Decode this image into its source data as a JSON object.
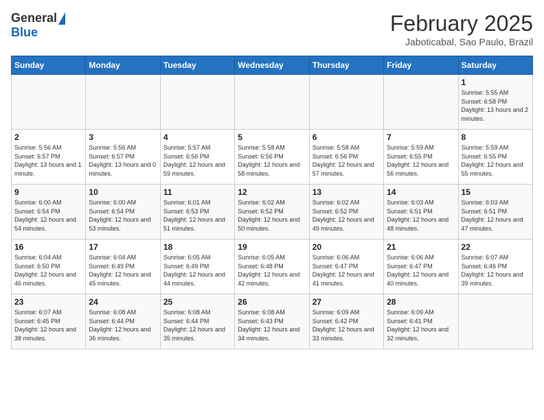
{
  "header": {
    "logo_general": "General",
    "logo_blue": "Blue",
    "month_year": "February 2025",
    "location": "Jaboticabal, Sao Paulo, Brazil"
  },
  "days_of_week": [
    "Sunday",
    "Monday",
    "Tuesday",
    "Wednesday",
    "Thursday",
    "Friday",
    "Saturday"
  ],
  "weeks": [
    [
      {
        "day": "",
        "info": ""
      },
      {
        "day": "",
        "info": ""
      },
      {
        "day": "",
        "info": ""
      },
      {
        "day": "",
        "info": ""
      },
      {
        "day": "",
        "info": ""
      },
      {
        "day": "",
        "info": ""
      },
      {
        "day": "1",
        "info": "Sunrise: 5:55 AM\nSunset: 6:58 PM\nDaylight: 13 hours and 2 minutes."
      }
    ],
    [
      {
        "day": "2",
        "info": "Sunrise: 5:56 AM\nSunset: 6:57 PM\nDaylight: 13 hours and 1 minute."
      },
      {
        "day": "3",
        "info": "Sunrise: 5:56 AM\nSunset: 6:57 PM\nDaylight: 13 hours and 0 minutes."
      },
      {
        "day": "4",
        "info": "Sunrise: 5:57 AM\nSunset: 6:56 PM\nDaylight: 12 hours and 59 minutes."
      },
      {
        "day": "5",
        "info": "Sunrise: 5:58 AM\nSunset: 6:56 PM\nDaylight: 12 hours and 58 minutes."
      },
      {
        "day": "6",
        "info": "Sunrise: 5:58 AM\nSunset: 6:56 PM\nDaylight: 12 hours and 57 minutes."
      },
      {
        "day": "7",
        "info": "Sunrise: 5:59 AM\nSunset: 6:55 PM\nDaylight: 12 hours and 56 minutes."
      },
      {
        "day": "8",
        "info": "Sunrise: 5:59 AM\nSunset: 6:55 PM\nDaylight: 12 hours and 55 minutes."
      }
    ],
    [
      {
        "day": "9",
        "info": "Sunrise: 6:00 AM\nSunset: 6:54 PM\nDaylight: 12 hours and 54 minutes."
      },
      {
        "day": "10",
        "info": "Sunrise: 6:00 AM\nSunset: 6:54 PM\nDaylight: 12 hours and 53 minutes."
      },
      {
        "day": "11",
        "info": "Sunrise: 6:01 AM\nSunset: 6:53 PM\nDaylight: 12 hours and 51 minutes."
      },
      {
        "day": "12",
        "info": "Sunrise: 6:02 AM\nSunset: 6:52 PM\nDaylight: 12 hours and 50 minutes."
      },
      {
        "day": "13",
        "info": "Sunrise: 6:02 AM\nSunset: 6:52 PM\nDaylight: 12 hours and 49 minutes."
      },
      {
        "day": "14",
        "info": "Sunrise: 6:03 AM\nSunset: 6:51 PM\nDaylight: 12 hours and 48 minutes."
      },
      {
        "day": "15",
        "info": "Sunrise: 6:03 AM\nSunset: 6:51 PM\nDaylight: 12 hours and 47 minutes."
      }
    ],
    [
      {
        "day": "16",
        "info": "Sunrise: 6:04 AM\nSunset: 6:50 PM\nDaylight: 12 hours and 46 minutes."
      },
      {
        "day": "17",
        "info": "Sunrise: 6:04 AM\nSunset: 6:49 PM\nDaylight: 12 hours and 45 minutes."
      },
      {
        "day": "18",
        "info": "Sunrise: 6:05 AM\nSunset: 6:49 PM\nDaylight: 12 hours and 44 minutes."
      },
      {
        "day": "19",
        "info": "Sunrise: 6:05 AM\nSunset: 6:48 PM\nDaylight: 12 hours and 42 minutes."
      },
      {
        "day": "20",
        "info": "Sunrise: 6:06 AM\nSunset: 6:47 PM\nDaylight: 12 hours and 41 minutes."
      },
      {
        "day": "21",
        "info": "Sunrise: 6:06 AM\nSunset: 6:47 PM\nDaylight: 12 hours and 40 minutes."
      },
      {
        "day": "22",
        "info": "Sunrise: 6:07 AM\nSunset: 6:46 PM\nDaylight: 12 hours and 39 minutes."
      }
    ],
    [
      {
        "day": "23",
        "info": "Sunrise: 6:07 AM\nSunset: 6:45 PM\nDaylight: 12 hours and 38 minutes."
      },
      {
        "day": "24",
        "info": "Sunrise: 6:08 AM\nSunset: 6:44 PM\nDaylight: 12 hours and 36 minutes."
      },
      {
        "day": "25",
        "info": "Sunrise: 6:08 AM\nSunset: 6:44 PM\nDaylight: 12 hours and 35 minutes."
      },
      {
        "day": "26",
        "info": "Sunrise: 6:08 AM\nSunset: 6:43 PM\nDaylight: 12 hours and 34 minutes."
      },
      {
        "day": "27",
        "info": "Sunrise: 6:09 AM\nSunset: 6:42 PM\nDaylight: 12 hours and 33 minutes."
      },
      {
        "day": "28",
        "info": "Sunrise: 6:09 AM\nSunset: 6:41 PM\nDaylight: 12 hours and 32 minutes."
      },
      {
        "day": "",
        "info": ""
      }
    ]
  ]
}
